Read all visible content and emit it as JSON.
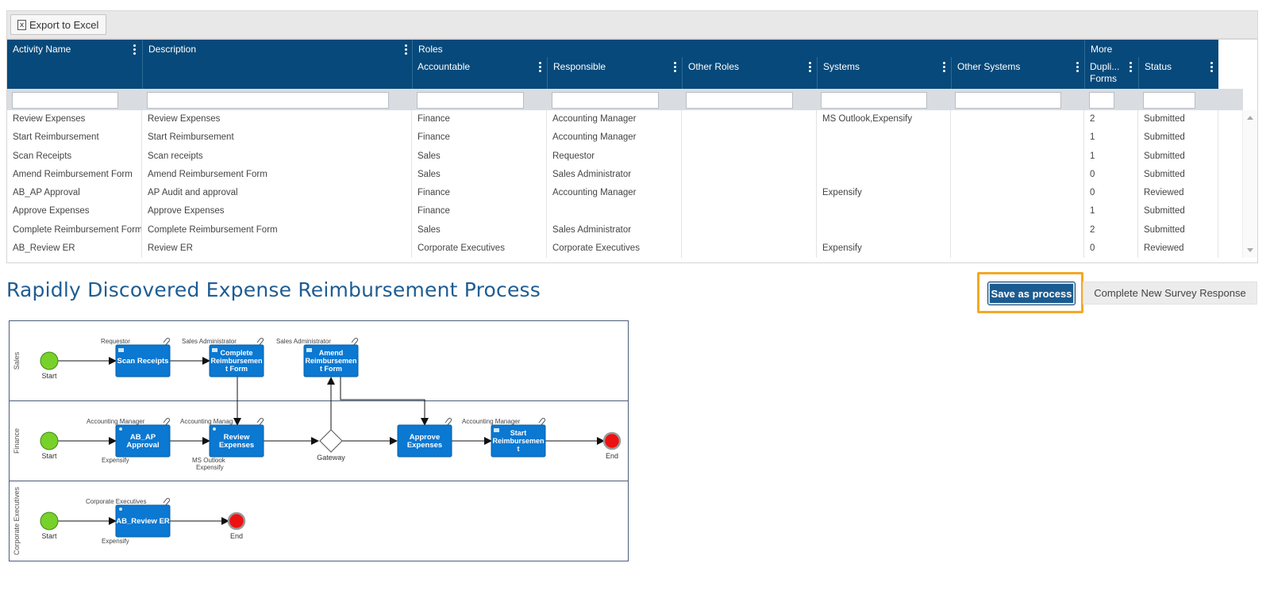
{
  "toolbar": {
    "export_label": "Export to Excel",
    "excel_glyph": "x"
  },
  "grid": {
    "groups": {
      "roles": "Roles",
      "more": "More"
    },
    "columns": {
      "activity": "Activity Name",
      "description": "Description",
      "accountable": "Accountable",
      "responsible": "Responsible",
      "other_roles": "Other Roles",
      "systems": "Systems",
      "other_systems": "Other Systems",
      "dup_forms": "Dupli...",
      "dup_forms_2": "Forms",
      "status": "Status"
    },
    "rows": [
      [
        "Review Expenses",
        "Review Expenses",
        "Finance",
        "Accounting Manager",
        "",
        "MS Outlook,Expensify",
        "",
        "2",
        "Submitted"
      ],
      [
        "Start Reimbursement",
        "Start Reimbursement",
        "Finance",
        "Accounting Manager",
        "",
        "",
        "",
        "1",
        "Submitted"
      ],
      [
        "Scan Receipts",
        "Scan receipts",
        "Sales",
        "Requestor",
        "",
        "",
        "",
        "1",
        "Submitted"
      ],
      [
        "Amend Reimbursement Form",
        "Amend Reimbursement Form",
        "Sales",
        "Sales Administrator",
        "",
        "",
        "",
        "0",
        "Submitted"
      ],
      [
        "AB_AP Approval",
        "AP Audit and approval",
        "Finance",
        "Accounting Manager",
        "",
        "Expensify",
        "",
        "0",
        "Reviewed"
      ],
      [
        "Approve Expenses",
        "Approve Expenses",
        "Finance",
        "",
        "",
        "",
        "",
        "1",
        "Submitted"
      ],
      [
        "Complete Reimbursement Form",
        "Complete Reimbursement Form",
        "Sales",
        "Sales Administrator",
        "",
        "",
        "",
        "2",
        "Submitted"
      ],
      [
        "AB_Review ER",
        "Review ER",
        "Corporate Executives",
        "Corporate Executives",
        "",
        "Expensify",
        "",
        "0",
        "Reviewed"
      ]
    ]
  },
  "process": {
    "title": "Rapidly Discovered Expense Reimbursement Process",
    "save_label": "Save as process",
    "survey_label": "Complete New Survey Response"
  },
  "diagram": {
    "lanes": [
      "Sales",
      "Finance",
      "Corporate Executives"
    ],
    "labels": {
      "start": "Start",
      "end": "End",
      "gateway": "Gateway",
      "requestor": "Requestor",
      "sales_admin": "Sales Administrator",
      "acct_mgr": "Accounting Manager",
      "acct_mgr_trunc": "Accounting Manag",
      "corp_exec": "Corporate Executives",
      "expensify": "Expensify",
      "ms_outlook": "MS Outlook"
    },
    "tasks": {
      "scan": [
        "Scan Receipts"
      ],
      "complete": [
        "Complete",
        "Reimbursemen",
        "t Form"
      ],
      "amend": [
        "Amend",
        "Reimbursemen",
        "t Form"
      ],
      "abap": [
        "AB_AP",
        "Approval"
      ],
      "review": [
        "Review",
        "Expenses"
      ],
      "approve": [
        "Approve",
        "Expenses"
      ],
      "start_reimb": [
        "Start",
        "Reimbursemen",
        "t"
      ],
      "abreview": [
        "AB_Review ER"
      ]
    },
    "colors": {
      "task": "#0b78d1",
      "start": "#78d12b",
      "end": "#ee1111",
      "lane_border": "#4b5d78"
    }
  }
}
